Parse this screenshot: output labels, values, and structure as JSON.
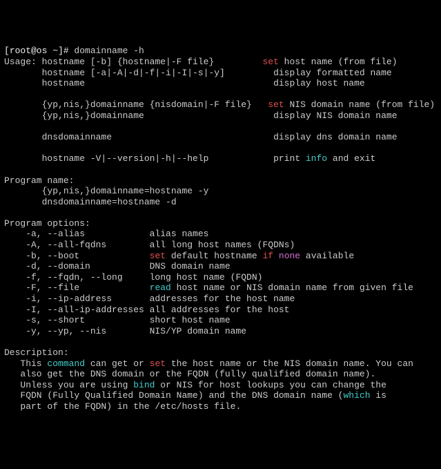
{
  "prompt": {
    "user_host": "[root@os ~]# ",
    "command": "domainname -h"
  },
  "usage": {
    "heading": "Usage:",
    "l1a": " hostname [-b] {hostname|-F file}         ",
    "l1b": "set",
    "l1c": " host name (from file)",
    "l2a": "       hostname [-a|-A|-d|-f|-i|-I|-s|-y]         display formatted name",
    "l3a": "       hostname                                   display host name",
    "blank1": " ",
    "l4a": "       {yp,nis,}domainname {nisdomain|-F file}   ",
    "l4b": "set",
    "l4c": " NIS domain name (from file)",
    "l5a": "       {yp,nis,}domainname                        display NIS domain name",
    "blank2": " ",
    "l6a": "       dnsdomainname                              display dns domain name",
    "blank3": " ",
    "l7a": "       hostname -V|--version|-h|--help            print ",
    "l7b": "info",
    "l7c": " and exit"
  },
  "program_name": {
    "heading": "Program name:",
    "l1": "       {yp,nis,}domainname=hostname -y",
    "l2": "       dnsdomainname=hostname -d"
  },
  "options": {
    "heading": "Program options:",
    "a": "    -a, --alias            alias names",
    "A": "    -A, --all-fqdns        all long host names (FQDNs)",
    "b1": "    -b, --boot             ",
    "b2": "set",
    "b3": " default hostname ",
    "b4": "if",
    "b5": " ",
    "b6": "none",
    "b7": " available",
    "d": "    -d, --domain           DNS domain name",
    "f": "    -f, --fqdn, --long     long host name (FQDN)",
    "F1": "    -F, --file             ",
    "F2": "read",
    "F3": " host name or NIS domain name from given file",
    "i": "    -i, --ip-address       addresses for the host name",
    "I": "    -I, --all-ip-addresses all addresses for the host",
    "s": "    -s, --short            short host name",
    "y": "    -y, --yp, --nis        NIS/YP domain name"
  },
  "description": {
    "heading": "Description:",
    "l1a": "   This ",
    "l1b": "command",
    "l1c": " can get or ",
    "l1d": "set",
    "l1e": " the host name or the NIS domain name. You can",
    "l2": "   also get the DNS domain or the FQDN (fully qualified domain name).",
    "l3a": "   Unless you are using ",
    "l3b": "bind",
    "l3c": " or NIS for host lookups you can change the",
    "l4a": "   FQDN (Fully Qualified Domain Name) and the DNS domain name (",
    "l4b": "which",
    "l4c": " is",
    "l5": "   part of the FQDN) in the /etc/hosts file."
  }
}
